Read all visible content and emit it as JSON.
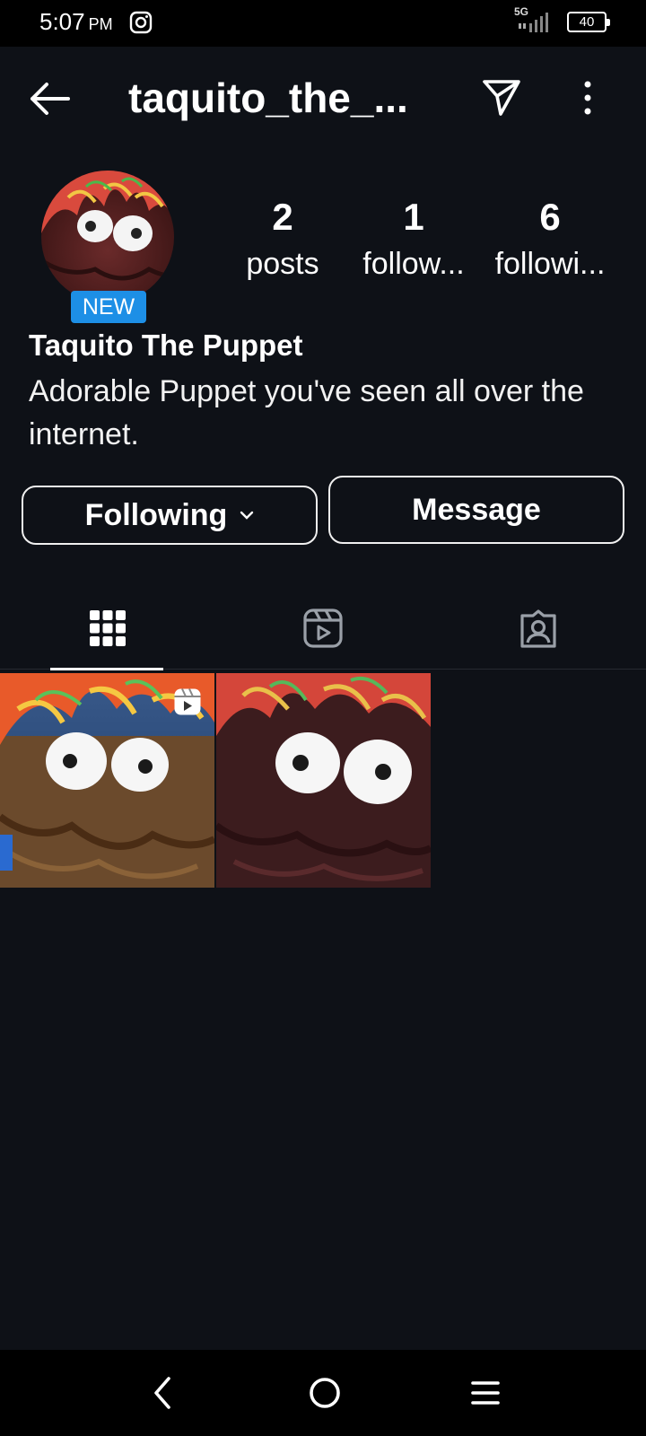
{
  "status_bar": {
    "time": "5:07",
    "ampm": "PM",
    "network": "5G",
    "battery": "40"
  },
  "header": {
    "username": "taquito_the_...",
    "icons": [
      "back-arrow-icon",
      "send-icon",
      "more-vertical-icon"
    ]
  },
  "profile": {
    "badge": "NEW",
    "display_name": "Taquito The Puppet",
    "bio": "Adorable Puppet you've seen all over the internet.",
    "stats": [
      {
        "count": "2",
        "label": "posts"
      },
      {
        "count": "1",
        "label": "follow..."
      },
      {
        "count": "6",
        "label": "followi..."
      }
    ]
  },
  "actions": {
    "following_label": "Following",
    "message_label": "Message"
  },
  "tabs": [
    {
      "name": "posts-grid",
      "icon": "grid-icon",
      "active": true
    },
    {
      "name": "reels",
      "icon": "reels-icon",
      "active": false
    },
    {
      "name": "tagged",
      "icon": "tagged-icon",
      "active": false
    }
  ],
  "posts": [
    {
      "type": "reel",
      "icon": "reel-icon"
    },
    {
      "type": "photo"
    }
  ],
  "nav": {
    "icons": [
      "nav-back-icon",
      "nav-home-icon",
      "nav-menu-icon"
    ]
  },
  "colors": {
    "background": "#0e1117",
    "badge": "#1d8fe6",
    "text": "#ffffff"
  }
}
